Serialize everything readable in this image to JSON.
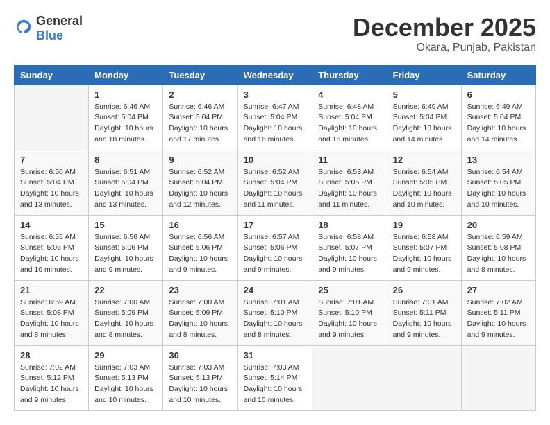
{
  "logo": {
    "general": "General",
    "blue": "Blue"
  },
  "title": "December 2025",
  "location": "Okara, Punjab, Pakistan",
  "days_header": [
    "Sunday",
    "Monday",
    "Tuesday",
    "Wednesday",
    "Thursday",
    "Friday",
    "Saturday"
  ],
  "weeks": [
    [
      {
        "day": "",
        "info": ""
      },
      {
        "day": "1",
        "info": "Sunrise: 6:46 AM\nSunset: 5:04 PM\nDaylight: 10 hours\nand 18 minutes."
      },
      {
        "day": "2",
        "info": "Sunrise: 6:46 AM\nSunset: 5:04 PM\nDaylight: 10 hours\nand 17 minutes."
      },
      {
        "day": "3",
        "info": "Sunrise: 6:47 AM\nSunset: 5:04 PM\nDaylight: 10 hours\nand 16 minutes."
      },
      {
        "day": "4",
        "info": "Sunrise: 6:48 AM\nSunset: 5:04 PM\nDaylight: 10 hours\nand 15 minutes."
      },
      {
        "day": "5",
        "info": "Sunrise: 6:49 AM\nSunset: 5:04 PM\nDaylight: 10 hours\nand 14 minutes."
      },
      {
        "day": "6",
        "info": "Sunrise: 6:49 AM\nSunset: 5:04 PM\nDaylight: 10 hours\nand 14 minutes."
      }
    ],
    [
      {
        "day": "7",
        "info": "Sunrise: 6:50 AM\nSunset: 5:04 PM\nDaylight: 10 hours\nand 13 minutes."
      },
      {
        "day": "8",
        "info": "Sunrise: 6:51 AM\nSunset: 5:04 PM\nDaylight: 10 hours\nand 13 minutes."
      },
      {
        "day": "9",
        "info": "Sunrise: 6:52 AM\nSunset: 5:04 PM\nDaylight: 10 hours\nand 12 minutes."
      },
      {
        "day": "10",
        "info": "Sunrise: 6:52 AM\nSunset: 5:04 PM\nDaylight: 10 hours\nand 11 minutes."
      },
      {
        "day": "11",
        "info": "Sunrise: 6:53 AM\nSunset: 5:05 PM\nDaylight: 10 hours\nand 11 minutes."
      },
      {
        "day": "12",
        "info": "Sunrise: 6:54 AM\nSunset: 5:05 PM\nDaylight: 10 hours\nand 10 minutes."
      },
      {
        "day": "13",
        "info": "Sunrise: 6:54 AM\nSunset: 5:05 PM\nDaylight: 10 hours\nand 10 minutes."
      }
    ],
    [
      {
        "day": "14",
        "info": "Sunrise: 6:55 AM\nSunset: 5:05 PM\nDaylight: 10 hours\nand 10 minutes."
      },
      {
        "day": "15",
        "info": "Sunrise: 6:56 AM\nSunset: 5:06 PM\nDaylight: 10 hours\nand 9 minutes."
      },
      {
        "day": "16",
        "info": "Sunrise: 6:56 AM\nSunset: 5:06 PM\nDaylight: 10 hours\nand 9 minutes."
      },
      {
        "day": "17",
        "info": "Sunrise: 6:57 AM\nSunset: 5:06 PM\nDaylight: 10 hours\nand 9 minutes."
      },
      {
        "day": "18",
        "info": "Sunrise: 6:58 AM\nSunset: 5:07 PM\nDaylight: 10 hours\nand 9 minutes."
      },
      {
        "day": "19",
        "info": "Sunrise: 6:58 AM\nSunset: 5:07 PM\nDaylight: 10 hours\nand 9 minutes."
      },
      {
        "day": "20",
        "info": "Sunrise: 6:59 AM\nSunset: 5:08 PM\nDaylight: 10 hours\nand 8 minutes."
      }
    ],
    [
      {
        "day": "21",
        "info": "Sunrise: 6:59 AM\nSunset: 5:08 PM\nDaylight: 10 hours\nand 8 minutes."
      },
      {
        "day": "22",
        "info": "Sunrise: 7:00 AM\nSunset: 5:09 PM\nDaylight: 10 hours\nand 8 minutes."
      },
      {
        "day": "23",
        "info": "Sunrise: 7:00 AM\nSunset: 5:09 PM\nDaylight: 10 hours\nand 8 minutes."
      },
      {
        "day": "24",
        "info": "Sunrise: 7:01 AM\nSunset: 5:10 PM\nDaylight: 10 hours\nand 8 minutes."
      },
      {
        "day": "25",
        "info": "Sunrise: 7:01 AM\nSunset: 5:10 PM\nDaylight: 10 hours\nand 9 minutes."
      },
      {
        "day": "26",
        "info": "Sunrise: 7:01 AM\nSunset: 5:11 PM\nDaylight: 10 hours\nand 9 minutes."
      },
      {
        "day": "27",
        "info": "Sunrise: 7:02 AM\nSunset: 5:11 PM\nDaylight: 10 hours\nand 9 minutes."
      }
    ],
    [
      {
        "day": "28",
        "info": "Sunrise: 7:02 AM\nSunset: 5:12 PM\nDaylight: 10 hours\nand 9 minutes."
      },
      {
        "day": "29",
        "info": "Sunrise: 7:03 AM\nSunset: 5:13 PM\nDaylight: 10 hours\nand 10 minutes."
      },
      {
        "day": "30",
        "info": "Sunrise: 7:03 AM\nSunset: 5:13 PM\nDaylight: 10 hours\nand 10 minutes."
      },
      {
        "day": "31",
        "info": "Sunrise: 7:03 AM\nSunset: 5:14 PM\nDaylight: 10 hours\nand 10 minutes."
      },
      {
        "day": "",
        "info": ""
      },
      {
        "day": "",
        "info": ""
      },
      {
        "day": "",
        "info": ""
      }
    ]
  ]
}
